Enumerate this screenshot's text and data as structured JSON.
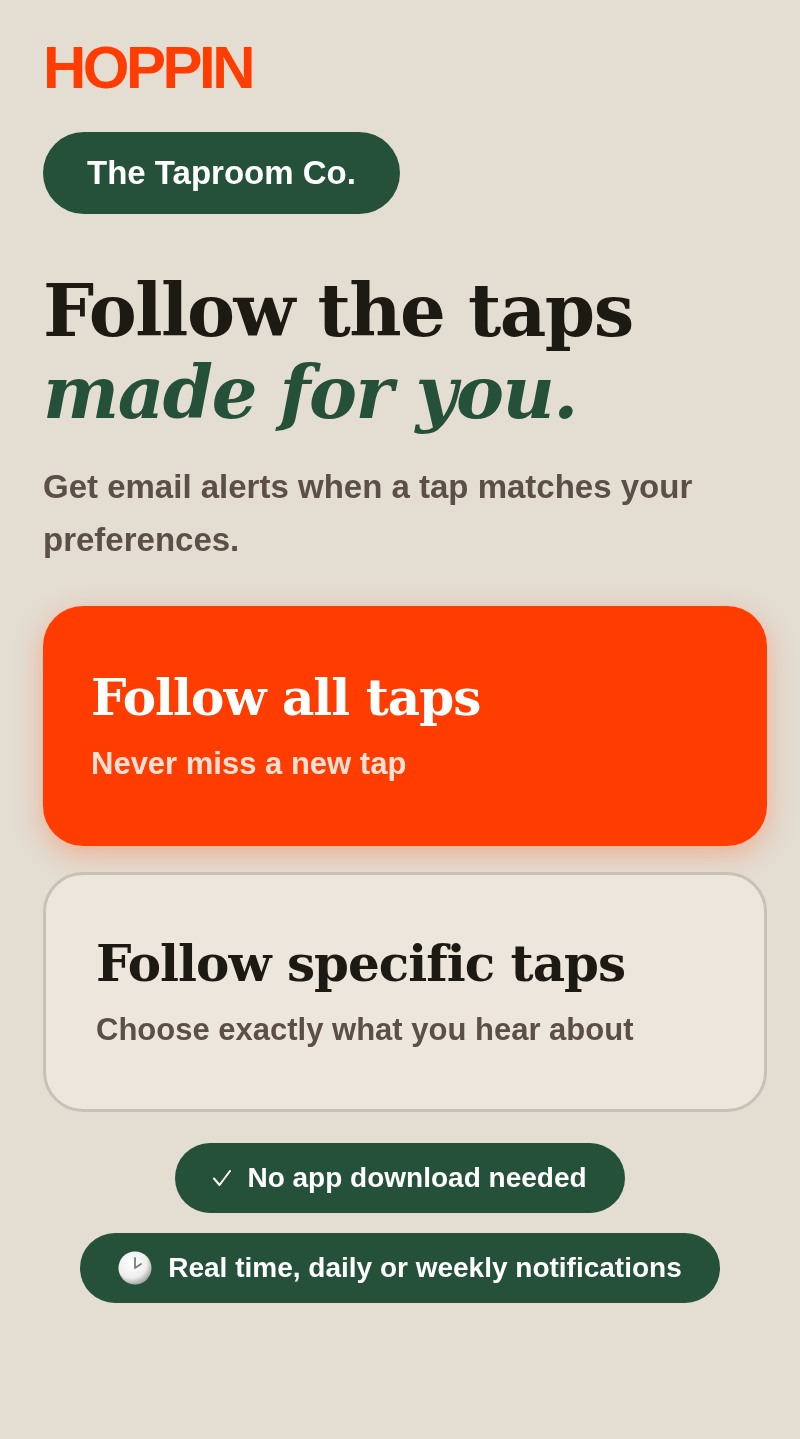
{
  "logo": {
    "text": "HOPPIN"
  },
  "venue_pill": {
    "label": "The Taproom Co."
  },
  "heading": {
    "line_1": "Follow the taps",
    "line_2": "made for you."
  },
  "subtitle": "Get email alerts when a tap matches your preferences.",
  "options": [
    {
      "title": "Follow all taps",
      "description": "Never miss a new tap",
      "selected": true
    },
    {
      "title": "Follow specific taps",
      "description": "Choose exactly what you hear about",
      "selected": false
    }
  ],
  "features": [
    {
      "kind": "check",
      "label": "No app download needed"
    },
    {
      "kind": "clock",
      "label": "Real time, daily or weekly notifications"
    }
  ]
}
